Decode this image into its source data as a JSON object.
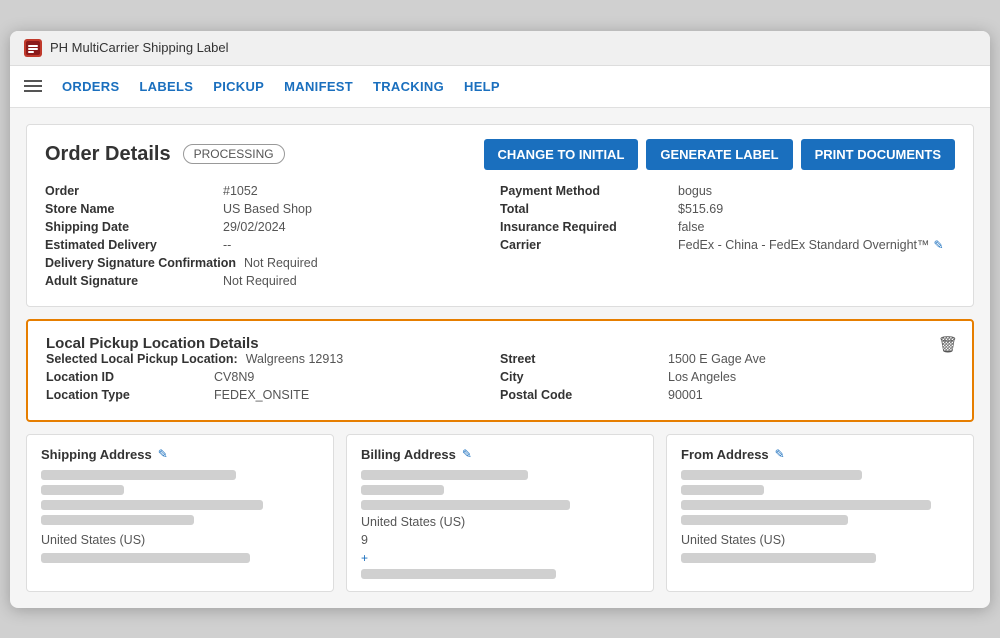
{
  "window": {
    "title": "PH MultiCarrier Shipping Label"
  },
  "nav": {
    "items": [
      {
        "label": "ORDERS",
        "id": "orders"
      },
      {
        "label": "LABELS",
        "id": "labels"
      },
      {
        "label": "PICKUP",
        "id": "pickup"
      },
      {
        "label": "MANIFEST",
        "id": "manifest"
      },
      {
        "label": "TRACKING",
        "id": "tracking"
      },
      {
        "label": "HELP",
        "id": "help"
      }
    ]
  },
  "orderDetails": {
    "title": "Order Details",
    "status": "PROCESSING",
    "buttons": {
      "changeToInitial": "CHANGE TO INITIAL",
      "generateLabel": "GENERATE LABEL",
      "printDocuments": "PRINT DOCUMENTS"
    },
    "fields": {
      "left": [
        {
          "label": "Order",
          "value": "#1052"
        },
        {
          "label": "Store Name",
          "value": "US Based Shop"
        },
        {
          "label": "Shipping Date",
          "value": "29/02/2024"
        },
        {
          "label": "Estimated Delivery",
          "value": "--"
        },
        {
          "label": "Delivery Signature Confirmation",
          "value": "Not Required"
        },
        {
          "label": "Adult Signature",
          "value": "Not Required"
        }
      ],
      "right": [
        {
          "label": "Payment Method",
          "value": "bogus"
        },
        {
          "label": "Total",
          "value": "$515.69"
        },
        {
          "label": "Insurance Required",
          "value": "false"
        },
        {
          "label": "Carrier",
          "value": "FedEx - China - FedEx Standard Overnight™"
        }
      ]
    }
  },
  "pickupLocation": {
    "title": "Local Pickup Location Details",
    "leftFields": [
      {
        "label": "Selected Local Pickup Location:",
        "value": "Walgreens 12913"
      },
      {
        "label": "Location ID",
        "value": "CV8N9"
      },
      {
        "label": "Location Type",
        "value": "FEDEX_ONSITE"
      }
    ],
    "rightFields": [
      {
        "label": "Street",
        "value": "1500 E Gage Ave"
      },
      {
        "label": "City",
        "value": "Los Angeles"
      },
      {
        "label": "Postal Code",
        "value": "90001"
      }
    ]
  },
  "addresses": {
    "shipping": {
      "title": "Shipping Address",
      "country": "United States (US)"
    },
    "billing": {
      "title": "Billing Address",
      "country": "United States (US)",
      "extra1": "9",
      "extra2": "+"
    },
    "from": {
      "title": "From Address",
      "country": "United States (US)"
    }
  }
}
